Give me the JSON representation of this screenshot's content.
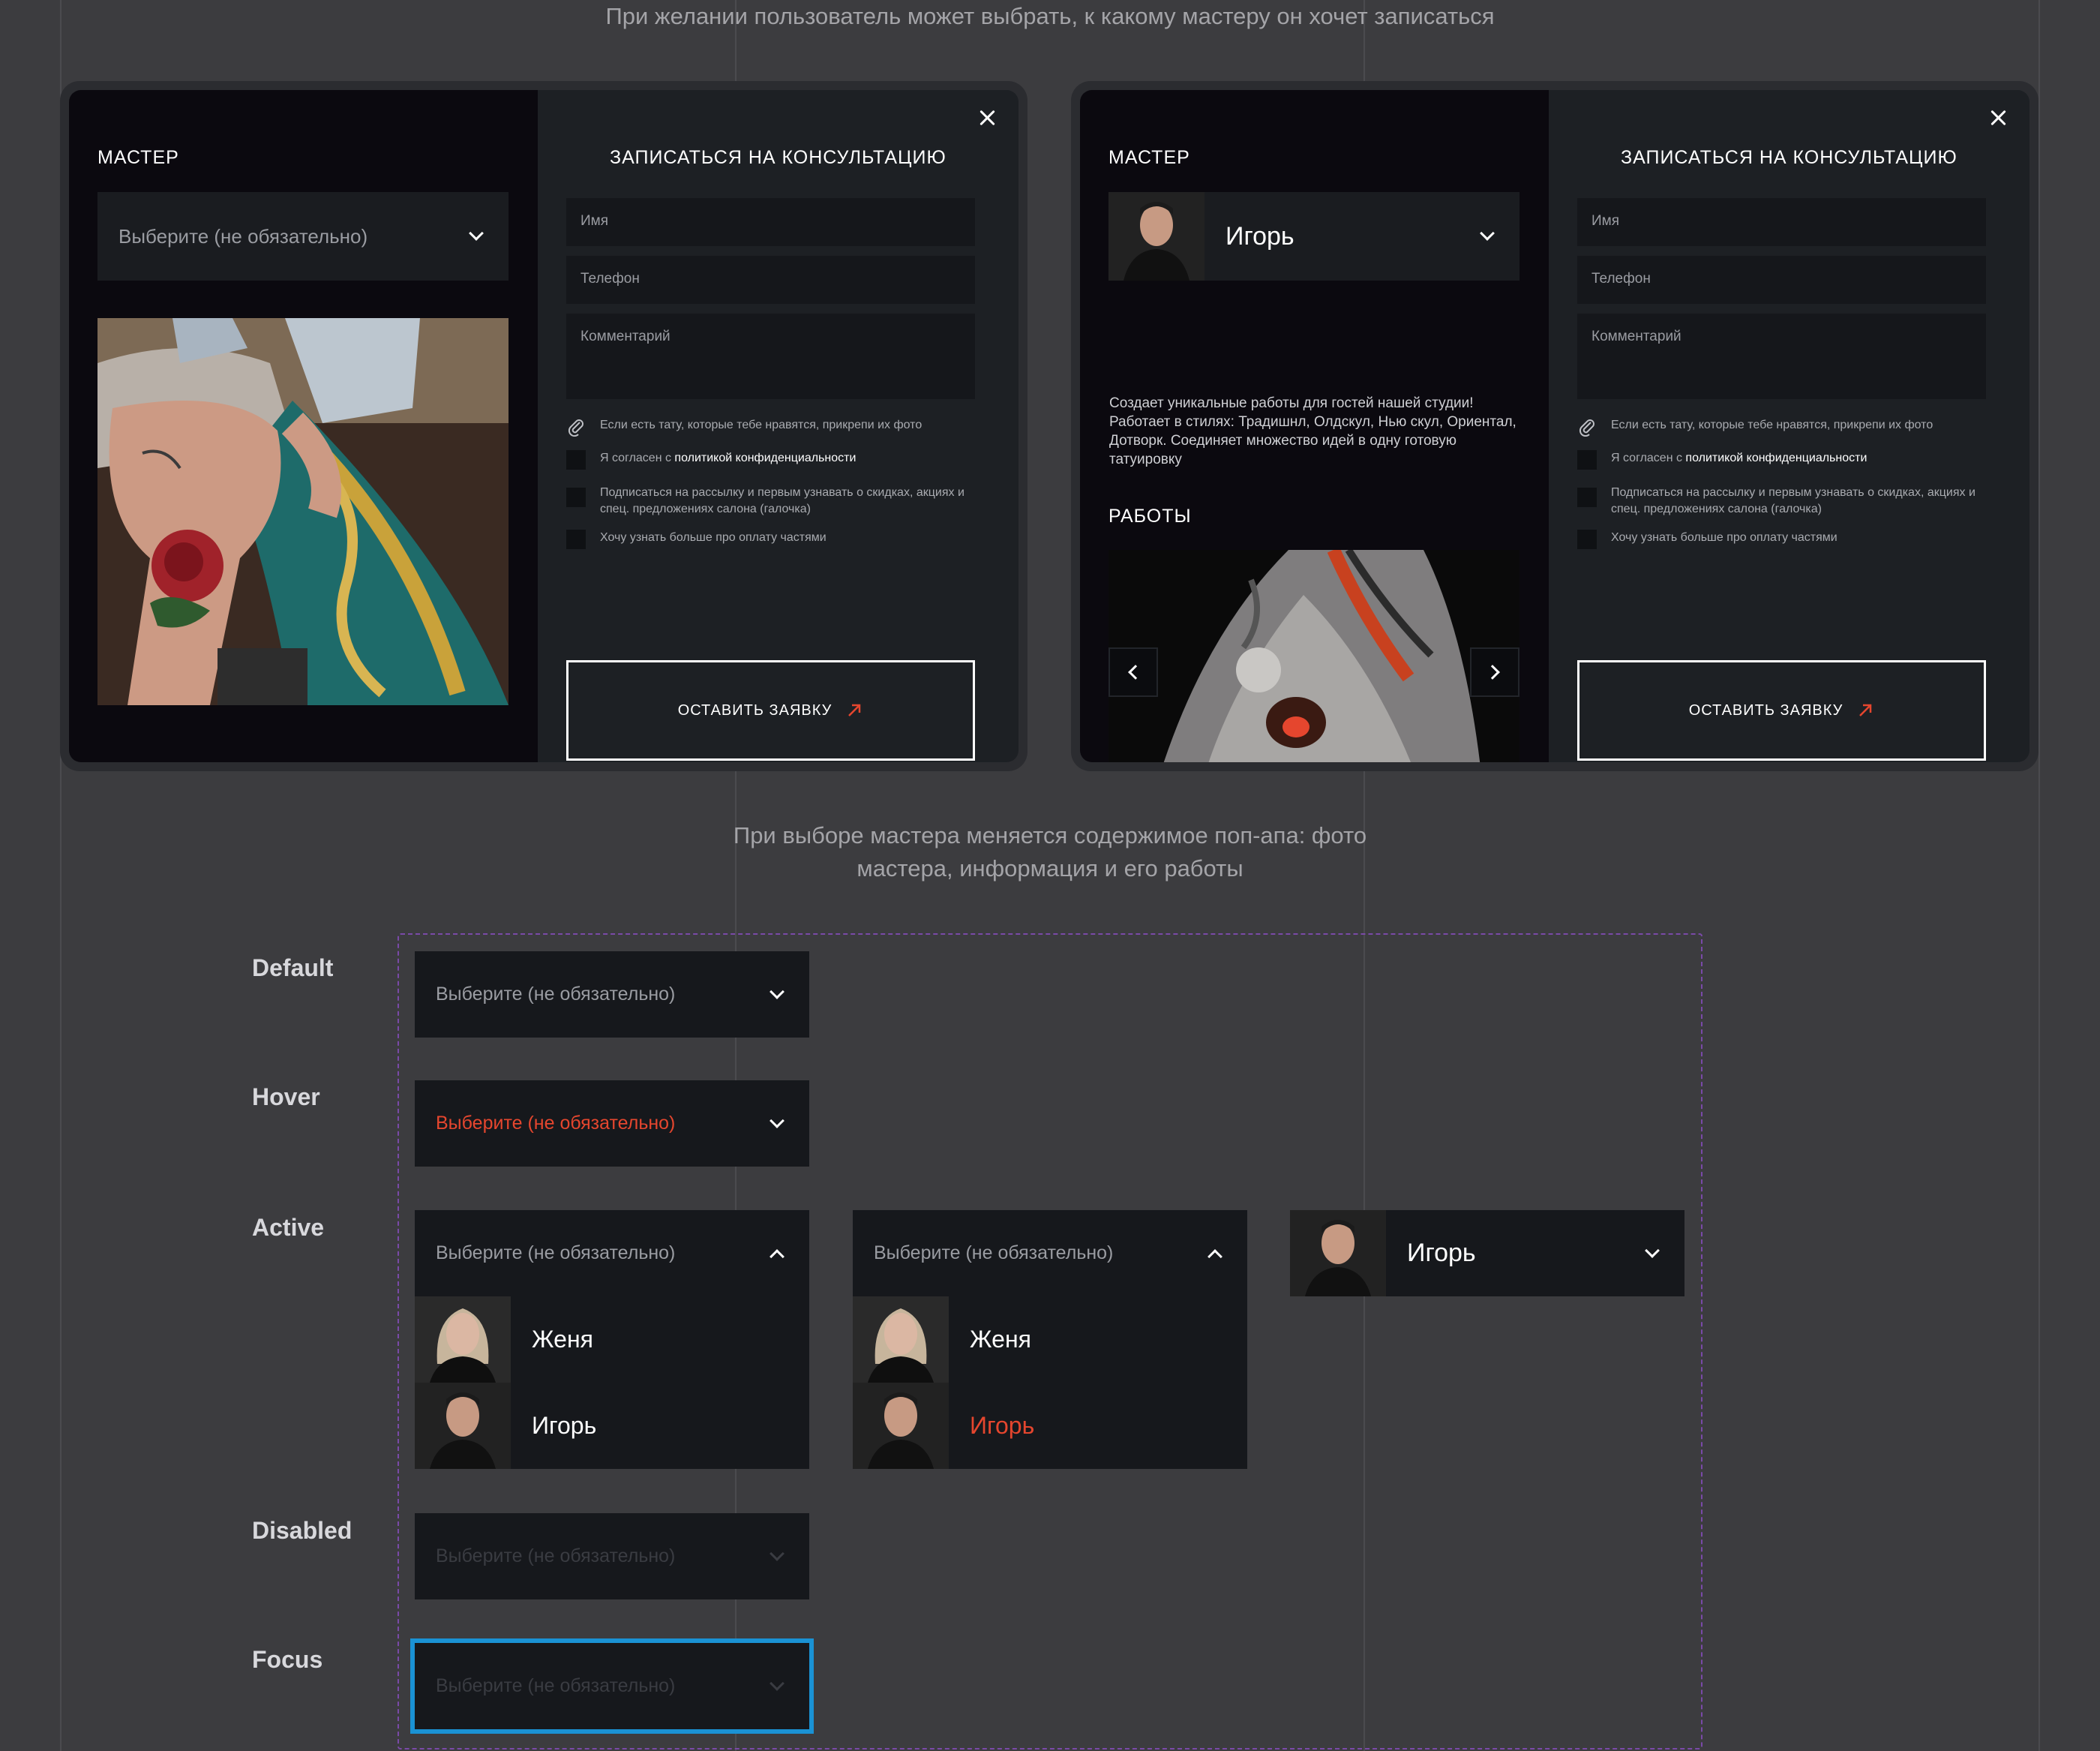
{
  "captions": {
    "top": "При желании пользователь может выбрать, к какому мастеру он хочет записаться",
    "middle_line1": "При выборе мастера меняется содержимое поп-апа: фото",
    "middle_line2": "мастера, информация и его работы"
  },
  "popup_left": {
    "master_title": "МАСТЕР",
    "select_placeholder": "Выберите (не обязательно)",
    "form_title": "ЗАПИСАТЬСЯ НА КОНСУЛЬТАЦИЮ",
    "name_placeholder": "Имя",
    "phone_placeholder": "Телефон",
    "comment_placeholder": "Комментарий",
    "attach_text": "Если есть тату, которые тебе нравятся, прикрепи их фото",
    "consent_prefix": "Я согласен с ",
    "consent_link": "политикой конфиденциальности",
    "subscribe_text": "Подписаться на рассылку и первым узнавать о скидках, акциях и спец. предложениях салона (галочка)",
    "installments_text": "Хочу узнать больше про оплату частями",
    "submit_label": "ОСТАВИТЬ ЗАЯВКУ"
  },
  "popup_right": {
    "master_title": "МАСТЕР",
    "selected_master": "Игорь",
    "description": "Создает уникальные работы для гостей нашей студии! Работает в стилях: Традишнл, Олдскул, Нью скул, Ориентал, Дотворк. Соединяет множество идей в одну готовую татуировку",
    "works_title": "РАБОТЫ",
    "form_title": "ЗАПИСАТЬСЯ НА КОНСУЛЬТАЦИЮ",
    "name_placeholder": "Имя",
    "phone_placeholder": "Телефон",
    "comment_placeholder": "Комментарий",
    "attach_text": "Если есть тату, которые тебе нравятся, прикрепи их фото",
    "consent_prefix": "Я согласен с ",
    "consent_link": "политикой конфиденциальности",
    "subscribe_text": "Подписаться на рассылку и первым узнавать о скидках, акциях и спец. предложениях салона (галочка)",
    "installments_text": "Хочу узнать больше про оплату частями",
    "submit_label": "ОСТАВИТЬ ЗАЯВКУ"
  },
  "states": {
    "default_label": "Default",
    "hover_label": "Hover",
    "active_label": "Active",
    "disabled_label": "Disabled",
    "focus_label": "Focus",
    "placeholder": "Выберите (не обязательно)",
    "masters": [
      "Женя",
      "Игорь"
    ],
    "chosen": "Игорь"
  },
  "colors": {
    "accent": "#e5462e",
    "focus_ring": "#1a92d4",
    "frame_dash": "#7a4aa8"
  },
  "icons": [
    "close-icon",
    "chevron-down-icon",
    "chevron-up-icon",
    "paperclip-icon",
    "arrow-up-right-icon",
    "chevron-left-icon",
    "chevron-right-icon"
  ]
}
